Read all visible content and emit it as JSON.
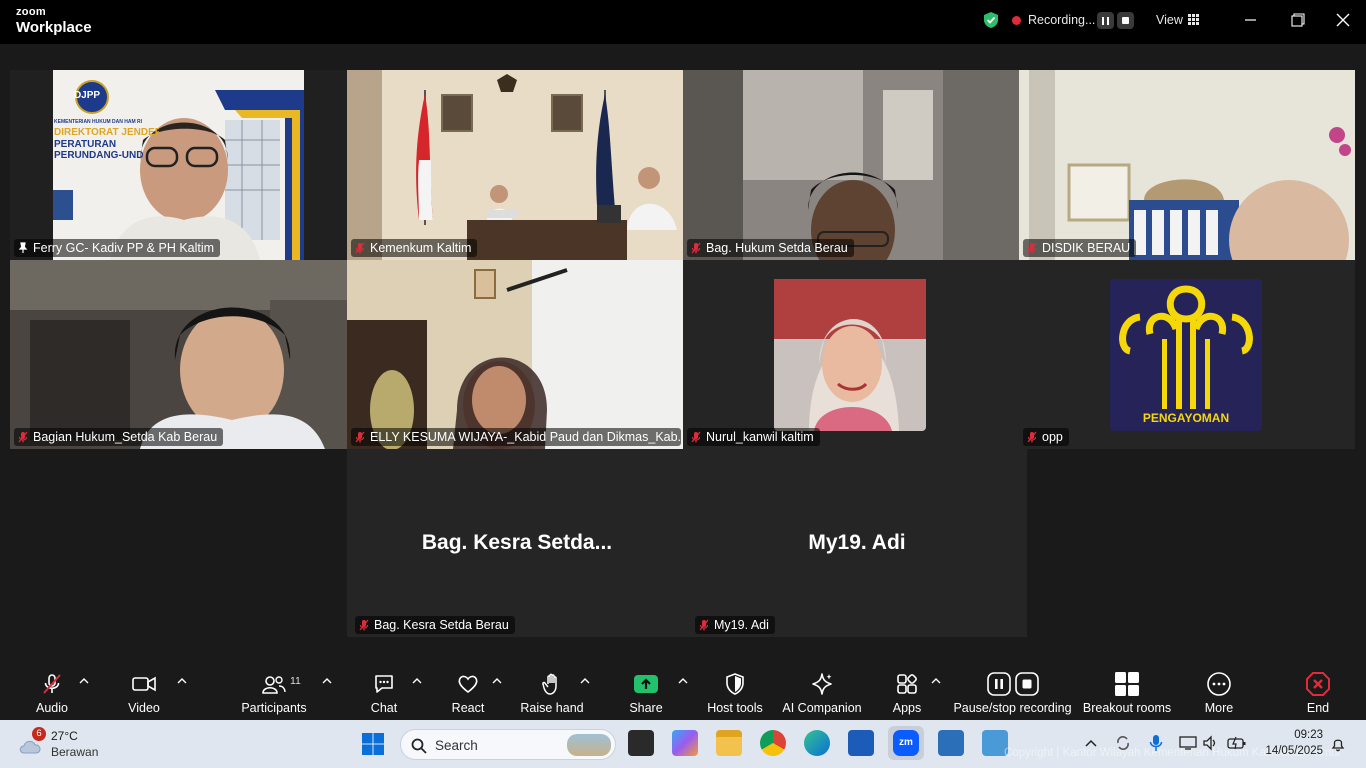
{
  "window": {
    "brand_top": "zoom",
    "brand_bottom": "Workplace",
    "recording_label": "Recording...",
    "view_label": "View",
    "shield_icon": "shield-check-icon",
    "accent_green": "#2ebd6b",
    "recording_red": "#e02b3b"
  },
  "tiles": [
    {
      "name": "Ferry GC- Kadiv PP & PH Kaltim",
      "muted": false,
      "active": true
    },
    {
      "name": "Kemenkum Kaltim",
      "muted": true
    },
    {
      "name": "Bag. Hukum Setda Berau",
      "muted": true
    },
    {
      "name": "DISDIK BERAU",
      "muted": true
    },
    {
      "name": "Bagian Hukum_Setda Kab Berau",
      "muted": true
    },
    {
      "name": "ELLY KESUMA WIJAYA-_Kabid Paud dan Dikmas_Kab...",
      "muted": true
    },
    {
      "name": "Nurul_kanwil kaltim",
      "muted": true
    },
    {
      "name": "opp",
      "muted": true,
      "logo_text": "PENGAYOMAN"
    },
    {
      "name": "Bag. Kesra Setda Berau",
      "display": "Bag. Kesra Setda...",
      "muted": true
    },
    {
      "name": "My19. Adi",
      "display": "My19. Adi",
      "muted": true
    }
  ],
  "slide_text": {
    "logo": "DJPP",
    "line1": "KEMENTERIAN HUKUM DAN HAM RI",
    "line2": "DIREKTORAT JENDERAL",
    "line3": "PERATURAN",
    "line4": "PERUNDANG-UNDANGAN"
  },
  "toolbar": {
    "audio": "Audio",
    "video": "Video",
    "participants": "Participants",
    "participants_count": "11",
    "chat": "Chat",
    "react": "React",
    "raise_hand": "Raise hand",
    "share": "Share",
    "host_tools": "Host tools",
    "ai_companion": "AI Companion",
    "apps": "Apps",
    "pause_stop": "Pause/stop recording",
    "breakout": "Breakout rooms",
    "more": "More",
    "end": "End"
  },
  "taskbar": {
    "weather_temp": "27°C",
    "weather_desc": "Berawan",
    "weather_badge": "6",
    "search_placeholder": "Search",
    "time": "09:23",
    "date": "14/05/2025",
    "watermark": "Copyright | Kantor Wilayah Kementerian Hukum Kalimantan Timur"
  }
}
